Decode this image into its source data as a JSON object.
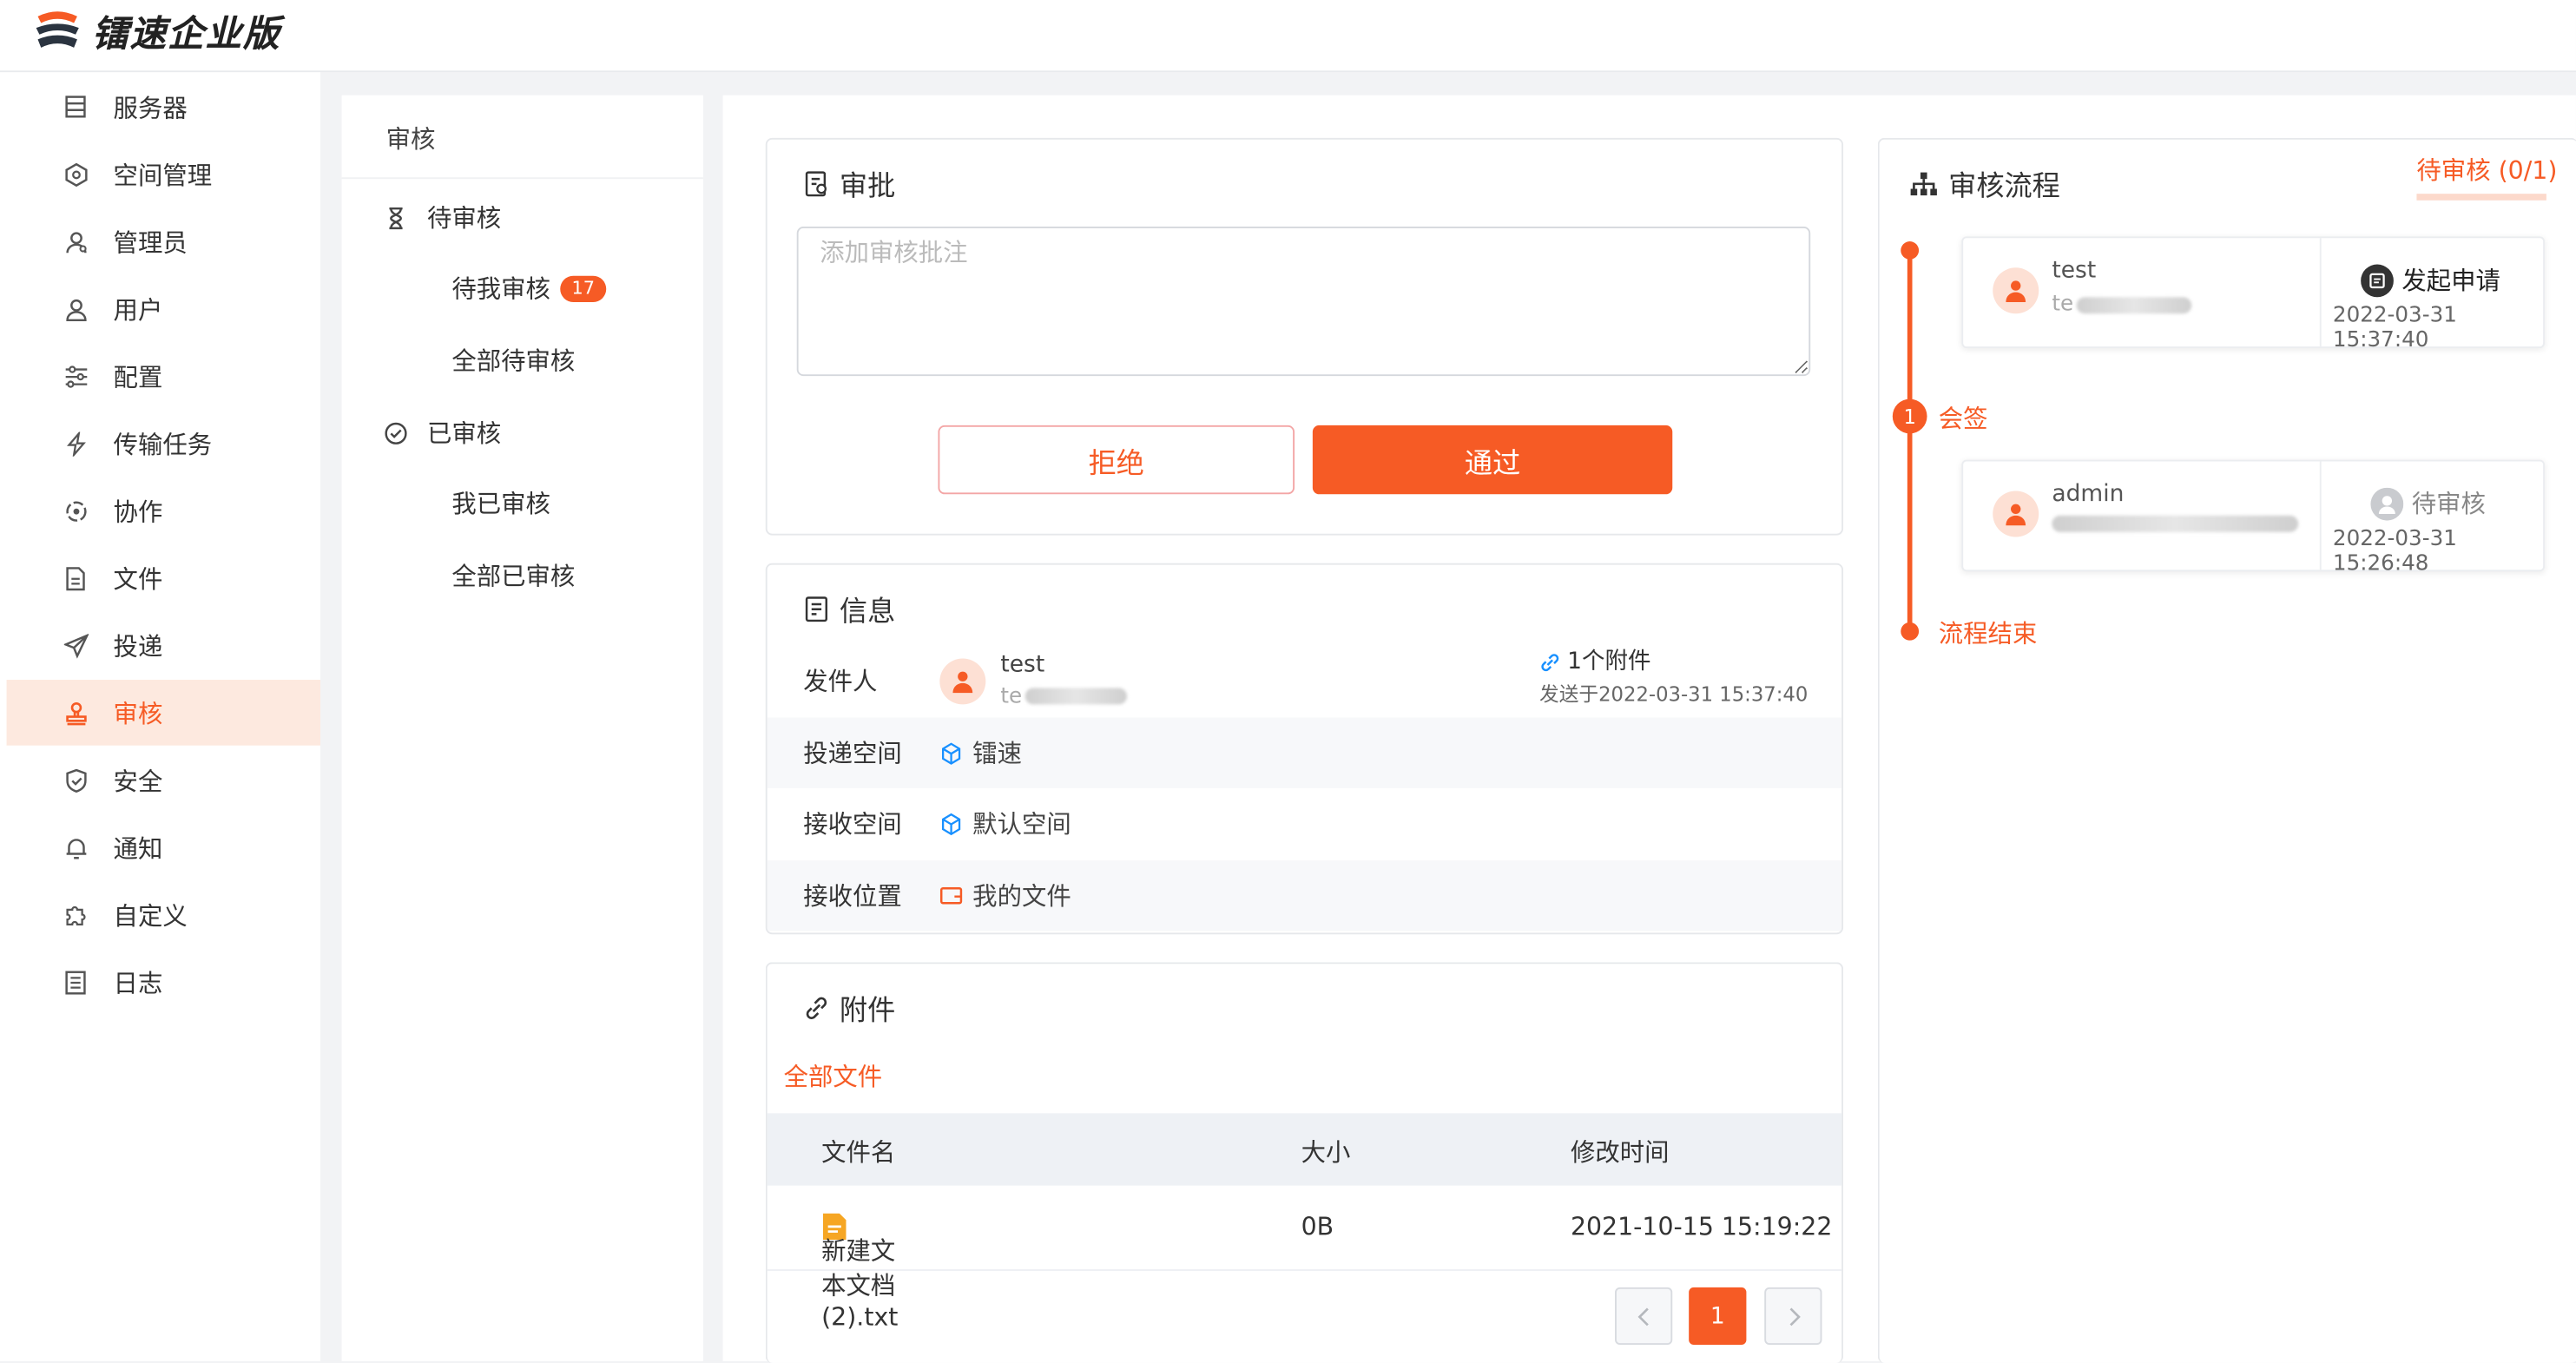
{
  "app": {
    "name": "镭速企业版"
  },
  "sidebar": {
    "items": [
      {
        "label": "服务器",
        "icon": "server-icon"
      },
      {
        "label": "空间管理",
        "icon": "space-icon"
      },
      {
        "label": "管理员",
        "icon": "admin-icon"
      },
      {
        "label": "用户",
        "icon": "user-icon"
      },
      {
        "label": "配置",
        "icon": "settings-sliders-icon"
      },
      {
        "label": "传输任务",
        "icon": "transfer-icon"
      },
      {
        "label": "协作",
        "icon": "collaborate-icon"
      },
      {
        "label": "文件",
        "icon": "file-icon"
      },
      {
        "label": "投递",
        "icon": "send-icon"
      },
      {
        "label": "审核",
        "icon": "stamp-icon",
        "active": true
      },
      {
        "label": "安全",
        "icon": "shield-icon"
      },
      {
        "label": "通知",
        "icon": "bell-icon"
      },
      {
        "label": "自定义",
        "icon": "puzzle-icon"
      },
      {
        "label": "日志",
        "icon": "log-icon"
      }
    ]
  },
  "submenu": {
    "title": "审核",
    "pending_group": "待审核",
    "pending_mine": "待我审核",
    "pending_mine_count": "17",
    "pending_all": "全部待审核",
    "done_group": "已审核",
    "done_mine": "我已审核",
    "done_all": "全部已审核"
  },
  "approve": {
    "title": "审批",
    "placeholder": "添加审核批注",
    "reject_label": "拒绝",
    "pass_label": "通过"
  },
  "info": {
    "title": "信息",
    "sender_label": "发件人",
    "sender_name": "test",
    "sender_email": "te",
    "attachments_count": "1个附件",
    "sent_at": "发送于2022-03-31 15:37:40",
    "delivery_space_label": "投递空间",
    "delivery_space": "镭速",
    "receive_space_label": "接收空间",
    "receive_space": "默认空间",
    "receive_location_label": "接收位置",
    "receive_location": "我的文件"
  },
  "attachments": {
    "title": "附件",
    "filter_all": "全部文件",
    "columns": [
      "文件名",
      "大小",
      "修改时间"
    ],
    "rows": [
      {
        "name": "新建文本文档 (2).txt",
        "size": "0B",
        "modified": "2021-10-15 15:19:22"
      }
    ],
    "page": "1"
  },
  "flow": {
    "title": "审核流程",
    "status_tab": "待审核 (0/1)",
    "steps": [
      {
        "user": "test",
        "email": "te",
        "action": "发起申请",
        "time": "2022-03-31 15:37:40"
      },
      {
        "user": "admin",
        "email": "",
        "action": "待审核",
        "time": "2022-03-31 15:26:48"
      }
    ],
    "countersign_num": "1",
    "countersign_label": "会签",
    "end_label": "流程结束"
  },
  "colors": {
    "accent": "#f65b25",
    "link": "#1890ff"
  }
}
